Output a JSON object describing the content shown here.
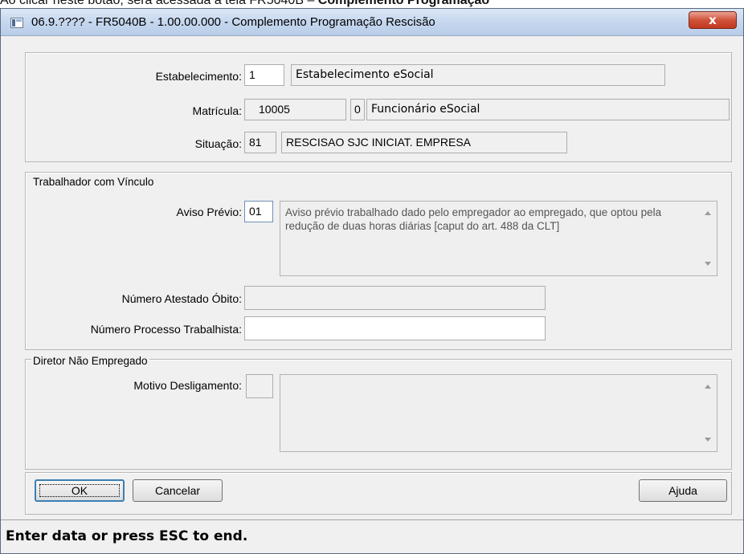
{
  "document": {
    "text_prefix": "Ao clicar neste botão, será acessada a tela FR5040B – ",
    "text_bold": "Complemento Programação"
  },
  "window": {
    "title": "06.9.???? - FR5040B - 1.00.00.000 - Complemento Programação Rescisão",
    "close_glyph": "x"
  },
  "header": {
    "estabelecimento": {
      "label": "Estabelecimento:",
      "code": "1",
      "desc": "Estabelecimento eSocial"
    },
    "matricula": {
      "label": "Matrícula:",
      "code": "10005",
      "seq": "0",
      "desc": "Funcionário eSocial"
    },
    "situacao": {
      "label": "Situação:",
      "code": "81",
      "desc": "RESCISAO SJC INICIAT. EMPRESA"
    }
  },
  "trabalhador": {
    "legend": "Trabalhador com Vínculo",
    "aviso_label": "Aviso Prévio:",
    "aviso_code": "01",
    "aviso_desc": "Aviso prévio trabalhado dado pelo empregador ao empregado, que optou pela redução de duas horas diárias [caput do art. 488 da CLT]",
    "atestado_label": "Número Atestado Óbito:",
    "atestado_value": "",
    "processo_label": "Número Processo Trabalhista:",
    "processo_value": ""
  },
  "diretor": {
    "legend": "Diretor Não Empregado",
    "motivo_label": "Motivo Desligamento:",
    "motivo_code": "",
    "motivo_desc": ""
  },
  "buttons": {
    "ok": "OK",
    "cancel": "Cancelar",
    "help": "Ajuda"
  },
  "status": {
    "message": "Enter data or press ESC to end."
  }
}
